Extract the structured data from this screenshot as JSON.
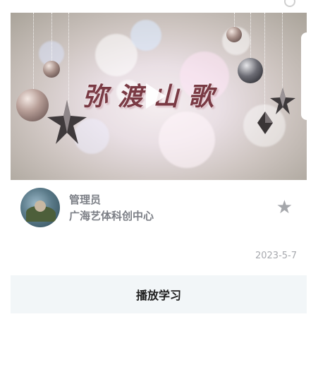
{
  "video": {
    "title_text": "弥渡山歌",
    "play_icon": "play-icon"
  },
  "author": {
    "name": "管理员",
    "organization": "广海艺体科创中心",
    "favorite_icon": "star-icon"
  },
  "post": {
    "date": "2023-5-7"
  },
  "actions": {
    "play_label": "播放学习"
  }
}
